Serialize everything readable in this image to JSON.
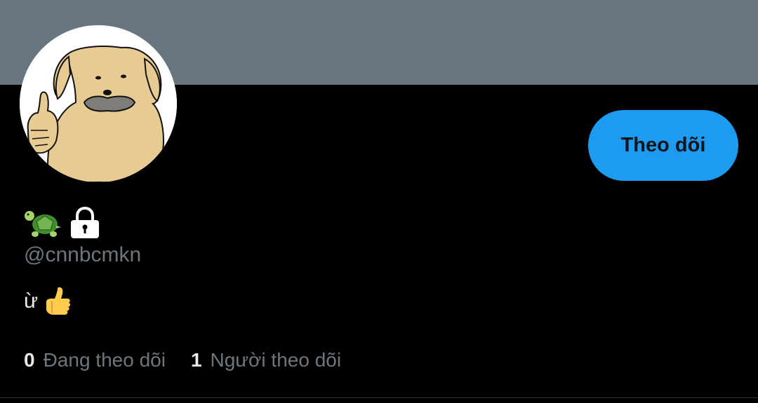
{
  "profile": {
    "banner_color": "#66757f",
    "avatar_icon": "dog-thumbs-up-avatar",
    "name_icons": [
      "turtle-emoji",
      "lock-icon"
    ],
    "handle": "@cnnbcmkn",
    "bio_text": "ừ",
    "bio_icon": "thumbs-up-emoji"
  },
  "follow_button": {
    "label": "Theo dõi",
    "color": "#1d9bf0"
  },
  "stats": {
    "following_count": "0",
    "following_label": "Đang theo dõi",
    "followers_count": "1",
    "followers_label": "Người theo dõi"
  }
}
